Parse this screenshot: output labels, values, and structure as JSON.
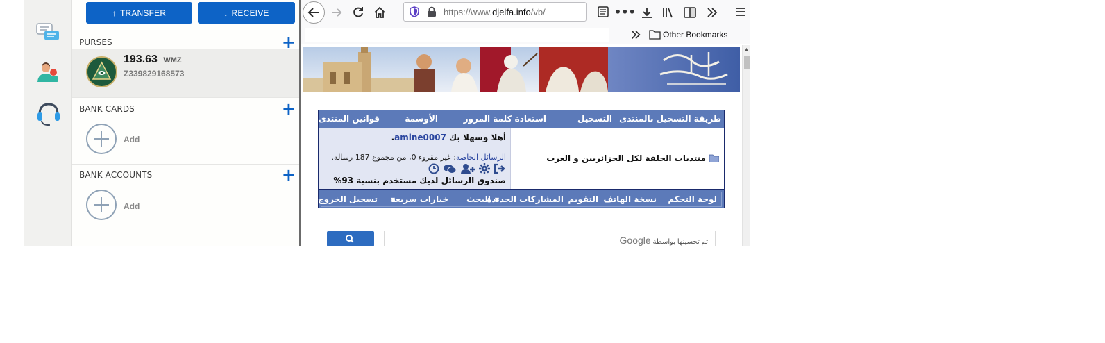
{
  "wallet": {
    "transfer_label": "TRANSFER",
    "receive_label": "RECEIVE",
    "purses": {
      "heading": "PURSES",
      "items": [
        {
          "amount": "193.63",
          "currency": "WMZ",
          "id": "Z339829168573"
        }
      ]
    },
    "bank_cards": {
      "heading": "BANK CARDS",
      "add_label": "Add"
    },
    "bank_accounts": {
      "heading": "BANK ACCOUNTS",
      "add_label": "Add"
    },
    "colors": {
      "accent": "#0d63c6",
      "purse_bg": "#ededeb"
    }
  },
  "browser": {
    "url": {
      "prefix": "https://www.",
      "host": "djelfa.info",
      "path": "/vb/"
    },
    "bookmarks": {
      "other_label": "Other Bookmarks"
    },
    "forum": {
      "top_nav": [
        "طريقة التسجيل بالمنتدى",
        "التسجيل",
        "استعادة كلمة المرور",
        "الأوسمة",
        "قوانين المنتدى"
      ],
      "site_title": "منتديات الجلفة لكل الجزائريين و العرب",
      "welcome_prefix": "أهلا وسهلا بك",
      "username": "amine0007",
      "pm_label": "الرسائل الخاصة",
      "pm_stats": ": غير مقروء 0، من مجموع 187 رسالة.",
      "mailbox_usage": "صندوق الرسائل لديك مستخدم بنسبة 93%",
      "bottom_nav": [
        "لوحة التحكم",
        "نسخة الهاتف",
        "التقويم",
        "المشاركات الجديدة",
        "البحث",
        "خيارات سريعة",
        "تسجيل الخروج"
      ],
      "search_powered": "تم تحسينها بواسطة",
      "google": "Google"
    },
    "colors": {
      "nav_bg": "#5c7ab9",
      "nav_border": "#1a2a6c"
    }
  }
}
